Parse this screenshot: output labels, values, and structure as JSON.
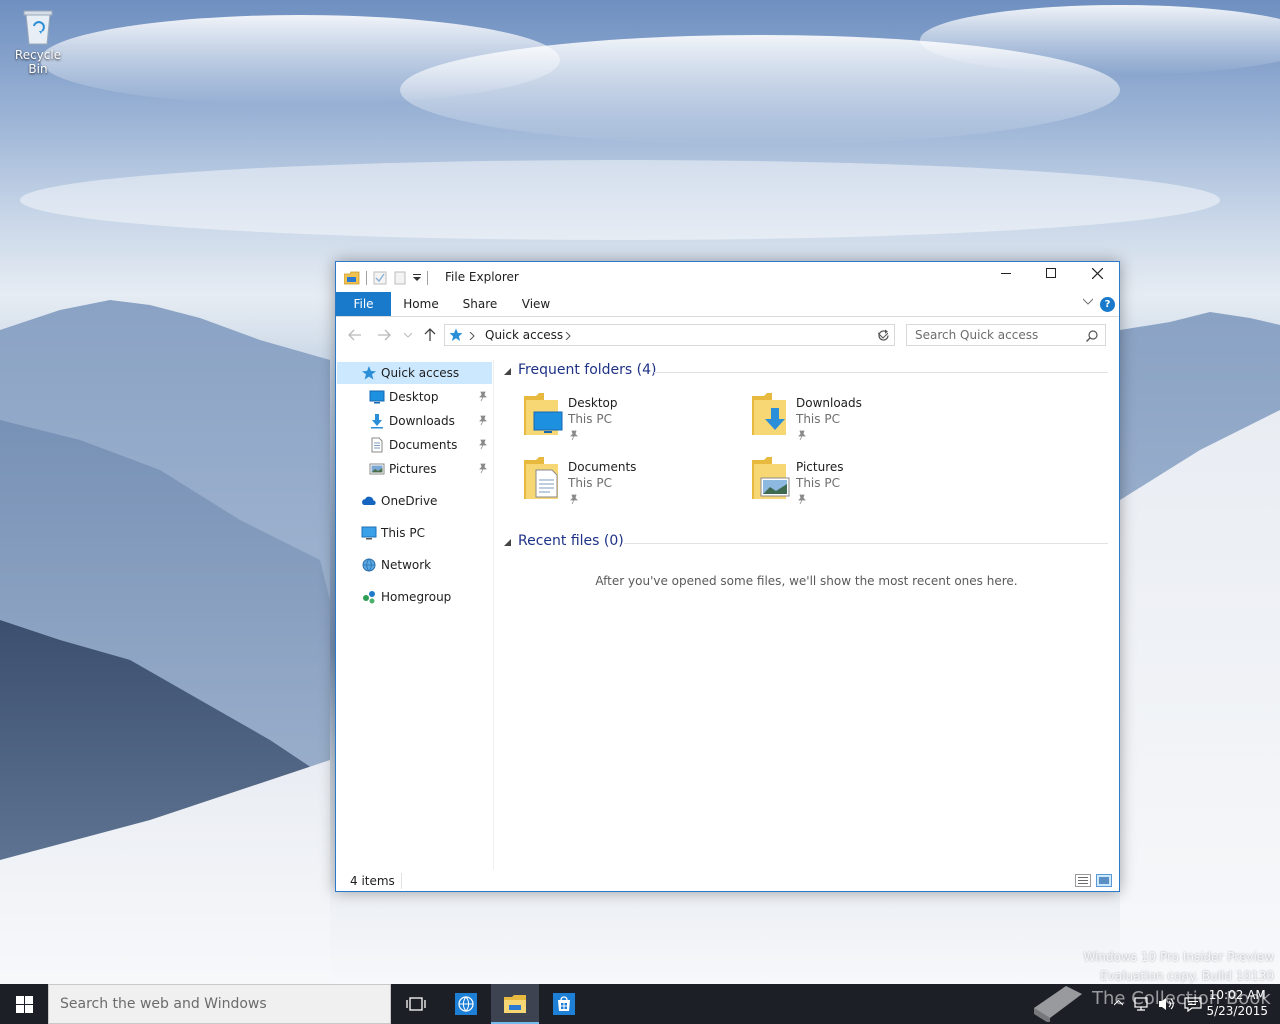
{
  "desktop": {
    "recycle_bin_label": "Recycle Bin",
    "watermark_line1": "Windows 10 Pro Insider Preview",
    "watermark_line2": "Evaluation copy. Build 10130",
    "collection_book": "The Collection Book"
  },
  "window": {
    "title": "File Explorer",
    "tabs": {
      "file": "File",
      "home": "Home",
      "share": "Share",
      "view": "View"
    },
    "help_label": "?",
    "breadcrumb": "Quick access",
    "search_placeholder": "Search Quick access",
    "accent_color": "#1979ca"
  },
  "navpane": {
    "quick_access": "Quick access",
    "desktop": "Desktop",
    "downloads": "Downloads",
    "documents": "Documents",
    "pictures": "Pictures",
    "onedrive": "OneDrive",
    "this_pc": "This PC",
    "network": "Network",
    "homegroup": "Homegroup"
  },
  "content": {
    "frequent_header": "Frequent folders (4)",
    "recent_header": "Recent files (0)",
    "empty_message": "After you've opened some files, we'll show the most recent ones here.",
    "folders": [
      {
        "name": "Desktop",
        "location": "This PC"
      },
      {
        "name": "Downloads",
        "location": "This PC"
      },
      {
        "name": "Documents",
        "location": "This PC"
      },
      {
        "name": "Pictures",
        "location": "This PC"
      }
    ]
  },
  "statusbar": {
    "item_count": "4 items"
  },
  "taskbar": {
    "search_placeholder": "Search the web and Windows",
    "time": "10:02 AM",
    "date": "5/23/2015"
  }
}
